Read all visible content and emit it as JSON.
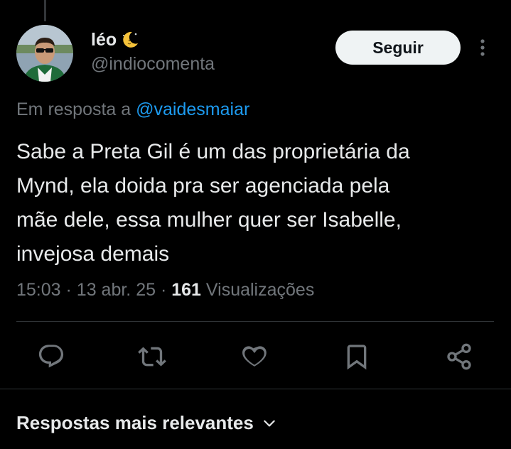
{
  "author": {
    "display_name": "léo",
    "display_name_emoji": "moon-icon",
    "handle": "@indiocomenta"
  },
  "follow_label": "Seguir",
  "reply_context": {
    "prefix": "Em resposta a",
    "mention": "@vaidesmaiar"
  },
  "tweet": {
    "lines": [
      "Sabe a Preta Gil é um das proprietária da",
      "Mynd, ela doida pra ser agenciada pela",
      "mãe dele, essa mulher quer ser Isabelle,",
      "invejosa demais"
    ]
  },
  "meta": {
    "time": "15:03",
    "sep1": "·",
    "date": "13 abr. 25",
    "sep2": "·",
    "views_count": "161",
    "views_label": "Visualizações"
  },
  "actions": [
    "reply-icon",
    "retweet-icon",
    "like-icon",
    "bookmark-icon",
    "share-icon"
  ],
  "replies_sort": {
    "label": "Respostas mais relevantes"
  },
  "colors": {
    "background": "#000000",
    "text": "#e7e9ea",
    "secondary": "#71767b",
    "link": "#1d9bf0",
    "divider": "#2f3336",
    "follow_bg": "#eff3f4"
  }
}
